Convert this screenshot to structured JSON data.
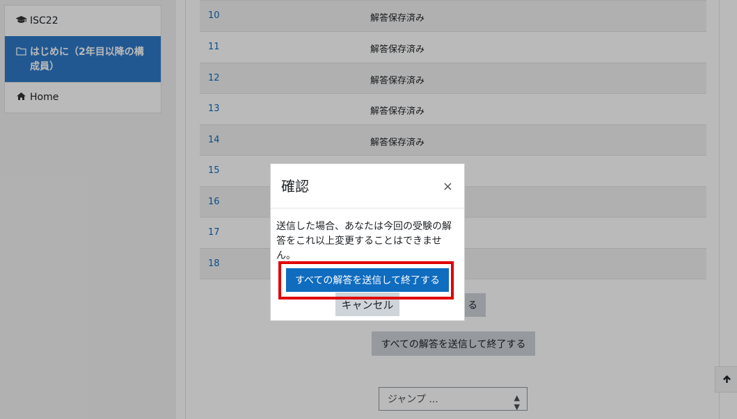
{
  "sidebar": {
    "items": [
      {
        "label": "ISC22",
        "icon": "graduation-cap-icon"
      },
      {
        "label": "はじめに（2年目以降の構成員）",
        "icon": "folder-icon"
      },
      {
        "label": "Home",
        "icon": "home-icon"
      }
    ]
  },
  "questions": [
    {
      "num": "10",
      "status": "解答保存済み"
    },
    {
      "num": "11",
      "status": "解答保存済み"
    },
    {
      "num": "12",
      "status": "解答保存済み"
    },
    {
      "num": "13",
      "status": "解答保存済み"
    },
    {
      "num": "14",
      "status": "解答保存済み"
    },
    {
      "num": "15",
      "status": ""
    },
    {
      "num": "16",
      "status": ""
    },
    {
      "num": "17",
      "status": ""
    },
    {
      "num": "18",
      "status": ""
    }
  ],
  "page": {
    "return_button_visible_fragment": "る",
    "submit_all_label": "すべての解答を送信して終了する",
    "jump_placeholder": "ジャンプ ...",
    "back_to_top_icon": "arrow-up-icon"
  },
  "modal": {
    "title": "確認",
    "close_symbol": "×",
    "body": "送信した場合、あなたは今回の受験の解答をこれ以上変更することはできません。",
    "submit_label": "すべての解答を送信して終了する",
    "cancel_label": "キャンセル"
  },
  "colors": {
    "accent": "#0f6cbf",
    "active_nav": "#2e79c8",
    "highlight": "#e00000"
  }
}
